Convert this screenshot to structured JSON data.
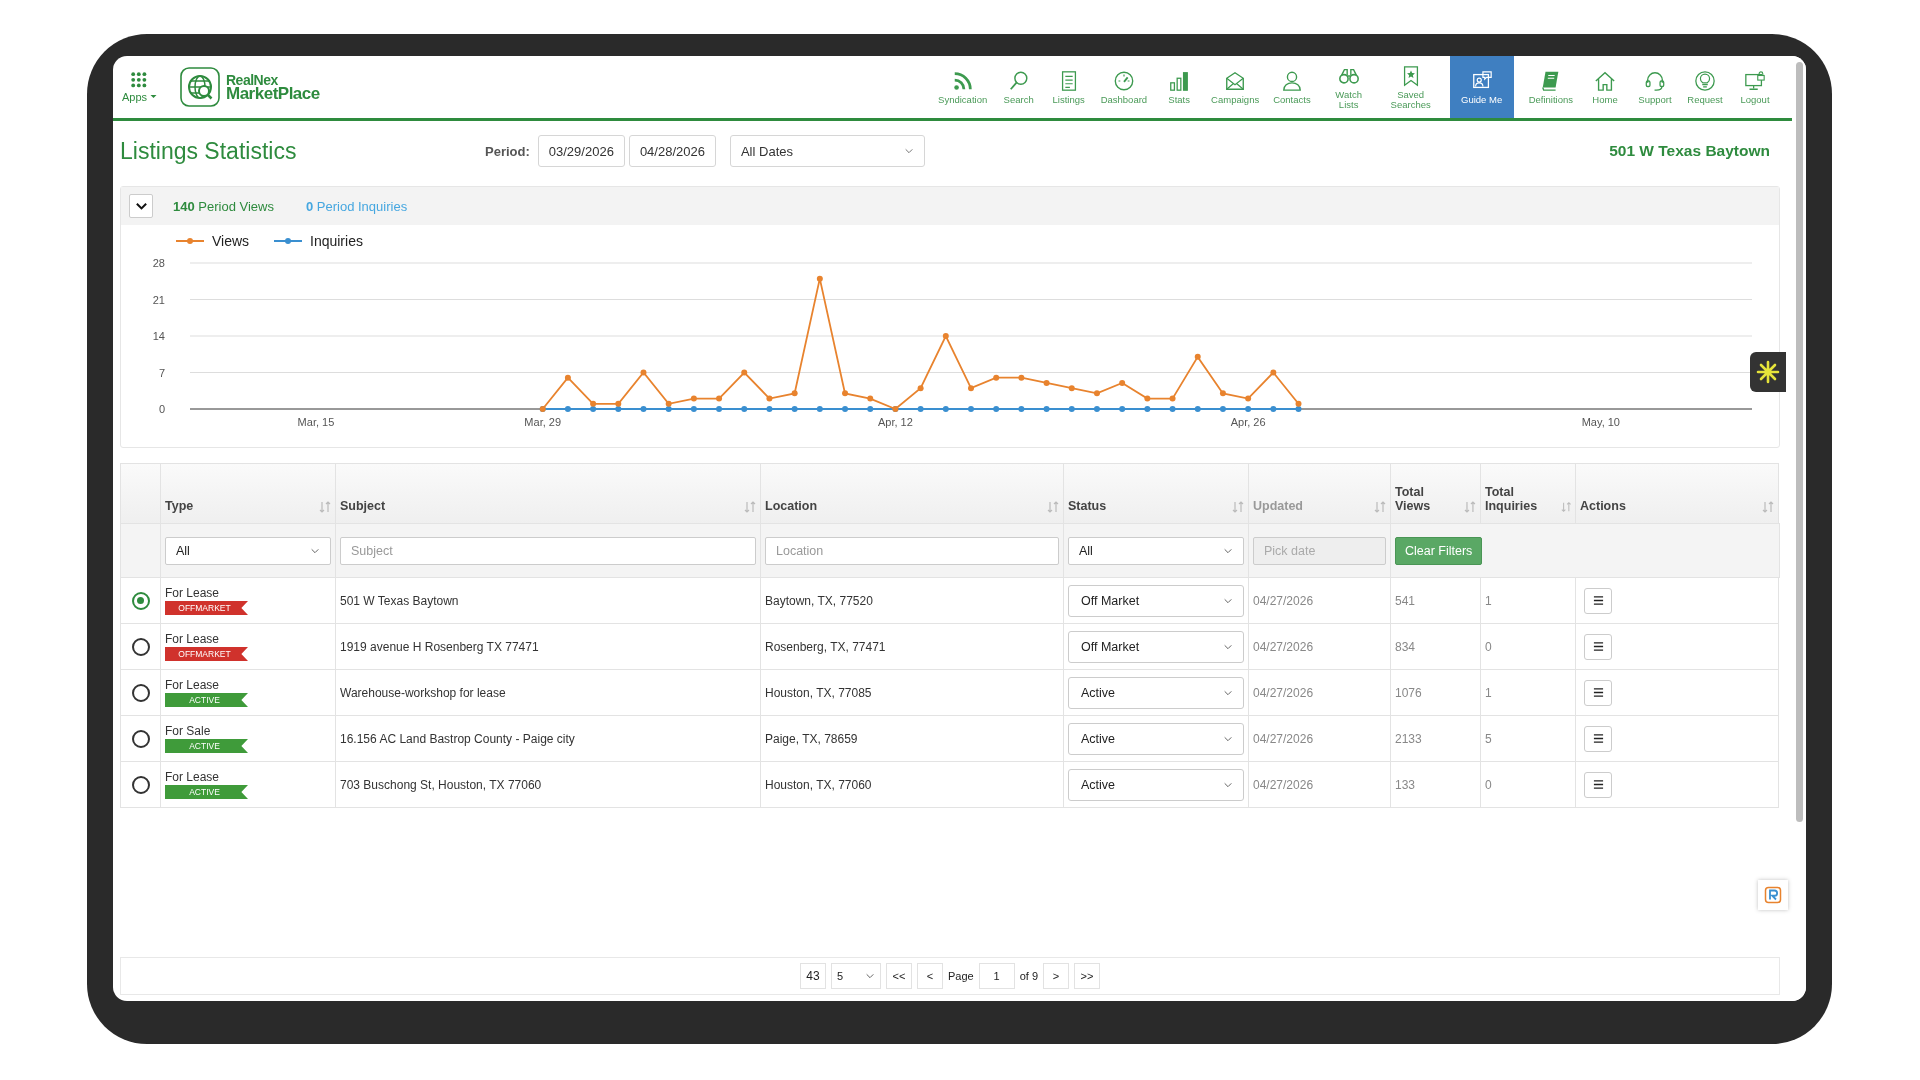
{
  "nav": {
    "apps_label": "Apps",
    "logo_line1": "RealNex",
    "logo_line2": "MarketPlace",
    "items": [
      {
        "label": "Syndication",
        "selected": false
      },
      {
        "label": "Search",
        "selected": false
      },
      {
        "label": "Listings",
        "selected": false
      },
      {
        "label": "Dashboard",
        "selected": false
      },
      {
        "label": "Stats",
        "selected": false
      },
      {
        "label": "Campaigns",
        "selected": false
      },
      {
        "label": "Contacts",
        "selected": false
      },
      {
        "label": "Watch Lists",
        "selected": false
      },
      {
        "label": "Saved Searches",
        "selected": false
      },
      {
        "label": "Guide Me",
        "selected": true
      },
      {
        "label": "Definitions",
        "selected": false
      },
      {
        "label": "Home",
        "selected": false
      },
      {
        "label": "Support",
        "selected": false
      },
      {
        "label": "Request",
        "selected": false
      },
      {
        "label": "Logout",
        "selected": false
      }
    ]
  },
  "header": {
    "title": "Listings Statistics",
    "period_label": "Period:",
    "start_date": "03/29/2026",
    "end_date": "04/28/2026",
    "range": "All Dates",
    "listing_name": "501 W Texas Baytown"
  },
  "summary": {
    "expanded": true,
    "views": "**140** Period Views",
    "inquiries": "**0** Period Inquiries",
    "chart_data": {
      "type": "line",
      "grid": true,
      "legend": "upper left",
      "categories": [
        null,
        null,
        null,
        null,
        null,
        "Mar, 15",
        null,
        null,
        null,
        null,
        null,
        null,
        null,
        null,
        "Mar, 29",
        null,
        null,
        null,
        null,
        null,
        null,
        null,
        null,
        null,
        null,
        null,
        null,
        null,
        "Apr, 12",
        null,
        null,
        null,
        null,
        null,
        null,
        null,
        null,
        null,
        null,
        null,
        null,
        null,
        "Apr, 26",
        null,
        null,
        null,
        null,
        null,
        null,
        null,
        null,
        null,
        null,
        null,
        null,
        null,
        "May, 10",
        null,
        null,
        null,
        null,
        null
      ],
      "series": [
        {
          "name": "Views",
          "color": "#e8832e",
          "marker": "circle",
          "values": [
            null,
            null,
            null,
            null,
            null,
            null,
            null,
            null,
            null,
            null,
            null,
            null,
            null,
            null,
            0,
            6,
            1,
            1,
            7,
            1,
            2,
            2,
            7,
            2,
            3,
            25,
            3,
            2,
            0,
            4,
            14,
            4,
            6,
            6,
            5,
            4,
            3,
            5,
            2,
            2,
            10,
            3,
            2,
            7,
            1,
            null,
            null,
            null,
            null,
            null,
            null,
            null,
            null,
            null,
            null,
            null,
            null,
            null,
            null,
            null,
            null,
            null
          ]
        },
        {
          "name": "Inquiries",
          "color": "#3a8fd0",
          "marker": "circle",
          "values": [
            null,
            null,
            null,
            null,
            null,
            null,
            null,
            null,
            null,
            null,
            null,
            null,
            null,
            null,
            0,
            0,
            0,
            0,
            0,
            0,
            0,
            0,
            0,
            0,
            0,
            0,
            0,
            0,
            0,
            0,
            0,
            0,
            0,
            0,
            0,
            0,
            0,
            0,
            0,
            0,
            0,
            0,
            0,
            0,
            0,
            null,
            null,
            null,
            null,
            null,
            null,
            null,
            null,
            null,
            null,
            null,
            null,
            null,
            null,
            null,
            null,
            null
          ]
        }
      ],
      "ylim": [
        0,
        28
      ],
      "yticks": [
        0,
        7,
        14,
        21,
        28
      ]
    }
  },
  "table": {
    "columns": [
      "Type",
      "Subject",
      "Location",
      "Status",
      "Updated",
      "Total Views",
      "Total Inquiries",
      "Actions"
    ],
    "filters": {
      "type": "All",
      "subject_placeholder": "Subject",
      "location_placeholder": "Location",
      "status": "All",
      "updated_placeholder": "Pick date",
      "clear_button": "Clear Filters"
    },
    "rows": [
      {
        "selected": true,
        "type": "For Lease",
        "tag": "OFFMARKET",
        "color": "#d0322c",
        "subject": "501 W Texas Baytown",
        "location": "Baytown, TX, 77520",
        "status": "Off Market",
        "updated": "04/27/2026",
        "total_views": "541",
        "total_inquiries": "1"
      },
      {
        "selected": false,
        "type": "For Lease",
        "tag": "OFFMARKET",
        "color": "#d0322c",
        "subject": "1919 avenue H Rosenberg TX 77471",
        "location": "Rosenberg, TX, 77471",
        "status": "Off Market",
        "updated": "04/27/2026",
        "total_views": "834",
        "total_inquiries": "0"
      },
      {
        "selected": false,
        "type": "For Lease",
        "tag": "ACTIVE",
        "color": "#3f9b3a",
        "subject": "Warehouse-workshop for lease",
        "location": "Houston, TX, 77085",
        "status": "Active",
        "updated": "04/27/2026",
        "total_views": "1076",
        "total_inquiries": "1"
      },
      {
        "selected": false,
        "type": "For Sale",
        "tag": "ACTIVE",
        "color": "#3f9b3a",
        "subject": "16.156 AC Land Bastrop County - Paige city",
        "location": "Paige, TX, 78659",
        "status": "Active",
        "updated": "04/27/2026",
        "total_views": "2133",
        "total_inquiries": "5"
      },
      {
        "selected": false,
        "type": "For Lease",
        "tag": "ACTIVE",
        "color": "#3f9b3a",
        "subject": "703 Buschong St, Houston, TX 77060",
        "location": "Houston, TX, 77060",
        "status": "Active",
        "updated": "04/27/2026",
        "total_views": "133",
        "total_inquiries": "0"
      }
    ]
  },
  "pager": {
    "total": "43",
    "page_size": "5",
    "first": "<<",
    "prev": "<",
    "page_label": "Page",
    "page": "1",
    "of_pages": "of 9",
    "next": ">",
    "last": ">>"
  }
}
